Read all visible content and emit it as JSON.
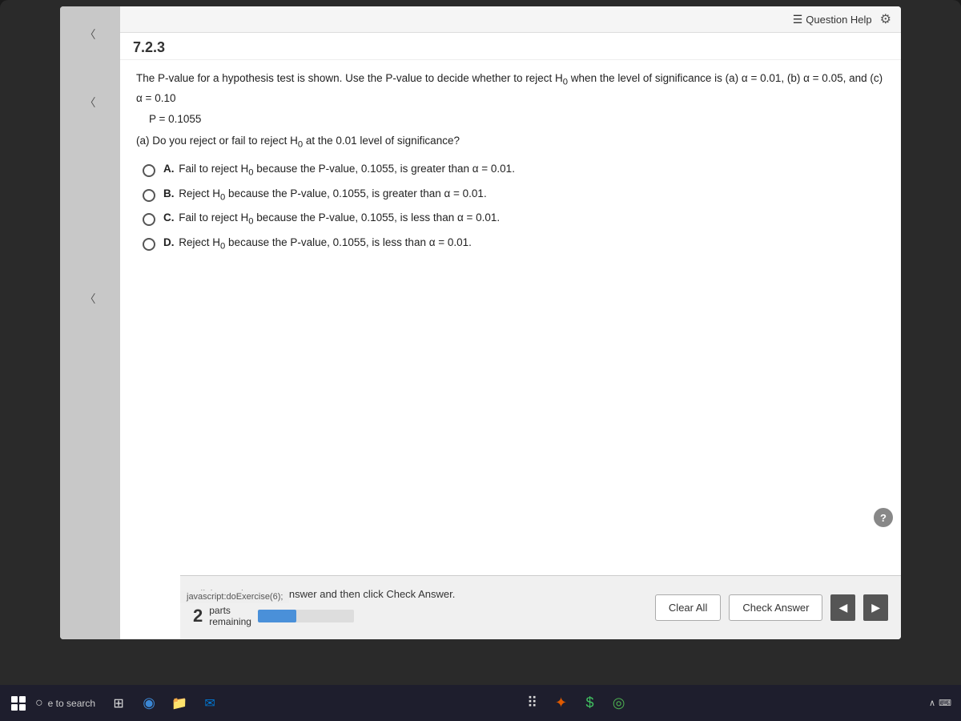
{
  "page": {
    "question_number": "7.2.3",
    "top_bar": {
      "question_help_label": "Question Help",
      "gear_icon": "⚙"
    },
    "question_intro": "The P-value for a hypothesis test is shown. Use the P-value to decide whether to reject H",
    "question_intro_sub": "0",
    "question_intro_suffix": " when the level of significance is (a) α = 0.01, (b) α = 0.05, and (c) α = 0.10",
    "p_value_line": "P = 0.1055",
    "sub_question_a": "(a) Do you reject or fail to reject H",
    "sub_question_a_sub": "0",
    "sub_question_a_suffix": " at the 0.01 level of significance?",
    "options": [
      {
        "label": "A.",
        "text": "Fail to reject H",
        "sub": "0",
        "suffix": " because the P-value, 0.1055, is greater than α = 0.01."
      },
      {
        "label": "B.",
        "text": "Reject  H",
        "sub": "0",
        "suffix": " because the P-value, 0.1055, is greater than α = 0.01."
      },
      {
        "label": "C.",
        "text": "Fail to reject H",
        "sub": "0",
        "suffix": " because the P-value, 0.1055, is less than α = 0.01."
      },
      {
        "label": "D.",
        "text": "Reject H",
        "sub": "0",
        "suffix": " because the P-value, 0.1055, is less than α = 0.01."
      }
    ],
    "bottom_bar": {
      "click_instruction": "Click to select your answer and then click Check Answer.",
      "parts_number": "2",
      "parts_label": "parts",
      "parts_remaining": "remaining",
      "clear_all_label": "Clear All",
      "check_answer_label": "Check Answer",
      "progress_pct": 40
    },
    "taskbar": {
      "search_placeholder": "e to search",
      "status_link": "javascript:doExercise(6);"
    }
  }
}
